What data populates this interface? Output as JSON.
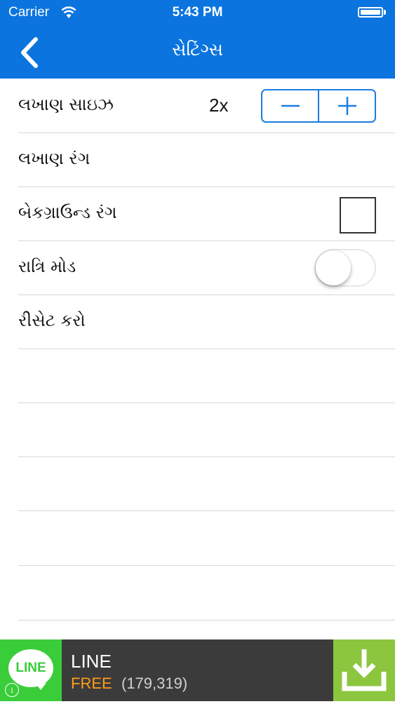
{
  "status_bar": {
    "carrier": "Carrier",
    "time": "5:43 PM"
  },
  "nav": {
    "title": "સેટિંગ્સ",
    "back_icon": "chevron-left-icon"
  },
  "settings": {
    "text_size": {
      "label": "લખાણ સાઇઝ",
      "value": "2x"
    },
    "text_color": {
      "label": "લખાણ રંગ"
    },
    "background_color": {
      "label": "બેકગ્રાઉન્ડ રંગ"
    },
    "night_mode": {
      "label": "રાત્રિ મોડ",
      "enabled": false
    },
    "reset": {
      "label": "રીસેટ કરો"
    }
  },
  "ad": {
    "logo_text": "LINE",
    "name": "LINE",
    "price": "FREE",
    "count": "(179,319)"
  },
  "colors": {
    "header": "#0b74de",
    "accent": "#1a7de0",
    "ad_logo": "#3acd3a",
    "ad_download": "#8cc63e",
    "ad_price": "#ff9d1b"
  }
}
